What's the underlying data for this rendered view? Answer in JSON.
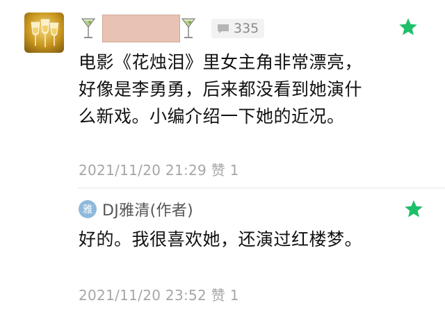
{
  "comment": {
    "comment_count": "335",
    "text": "电影《花烛泪》里女主角非常漂亮，好像是李勇勇，后来都没看到她演什么新戏。小编介绍一下她的近况。",
    "timestamp": "2021/11/20 21:29",
    "likes": "赞 1",
    "icons": {
      "avatar": "wine-glasses-avatar",
      "left_decoration": "martini-glass-icon",
      "right_decoration": "martini-glass-icon",
      "comment": "comment-bubble-icon",
      "star": "star-icon"
    }
  },
  "reply": {
    "author_badge": "雅",
    "author_name": "DJ雅清(作者)",
    "text": "好的。我很喜欢她，还演过红楼梦。",
    "timestamp": "2021/11/20 23:52",
    "likes": "赞 1"
  },
  "colors": {
    "star": "#1fbf6a",
    "meta_text": "#a6a6a6",
    "badge": "#8fb9dc"
  }
}
